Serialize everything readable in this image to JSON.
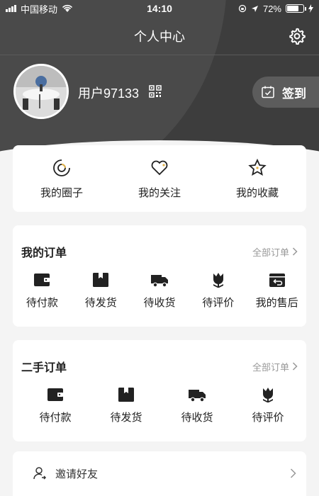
{
  "status_bar": {
    "carrier": "中国移动",
    "time": "14:10",
    "battery": "72%",
    "battery_level": 0.72
  },
  "nav": {
    "title": "个人中心"
  },
  "profile": {
    "username": "用户97133",
    "signin_label": "签到"
  },
  "quick_links": [
    {
      "label": "我的圈子",
      "icon": "circle-icon"
    },
    {
      "label": "我的关注",
      "icon": "heart-icon"
    },
    {
      "label": "我的收藏",
      "icon": "star-icon"
    }
  ],
  "orders": {
    "title": "我的订单",
    "more": "全部订单",
    "items": [
      {
        "label": "待付款",
        "icon": "wallet-icon"
      },
      {
        "label": "待发货",
        "icon": "box-icon"
      },
      {
        "label": "待收货",
        "icon": "truck-icon"
      },
      {
        "label": "待评价",
        "icon": "flower-icon"
      },
      {
        "label": "我的售后",
        "icon": "return-icon"
      }
    ]
  },
  "second_hand": {
    "title": "二手订单",
    "more": "全部订单",
    "items": [
      {
        "label": "待付款",
        "icon": "wallet-icon"
      },
      {
        "label": "待发货",
        "icon": "box-icon"
      },
      {
        "label": "待收货",
        "icon": "truck-icon"
      },
      {
        "label": "待评价",
        "icon": "flower-icon"
      }
    ]
  },
  "menu": [
    {
      "label": "邀请好友",
      "icon": "invite-user-icon"
    }
  ],
  "colors": {
    "header": "#3d3d3d",
    "accent_gold": "#e0b24a"
  }
}
